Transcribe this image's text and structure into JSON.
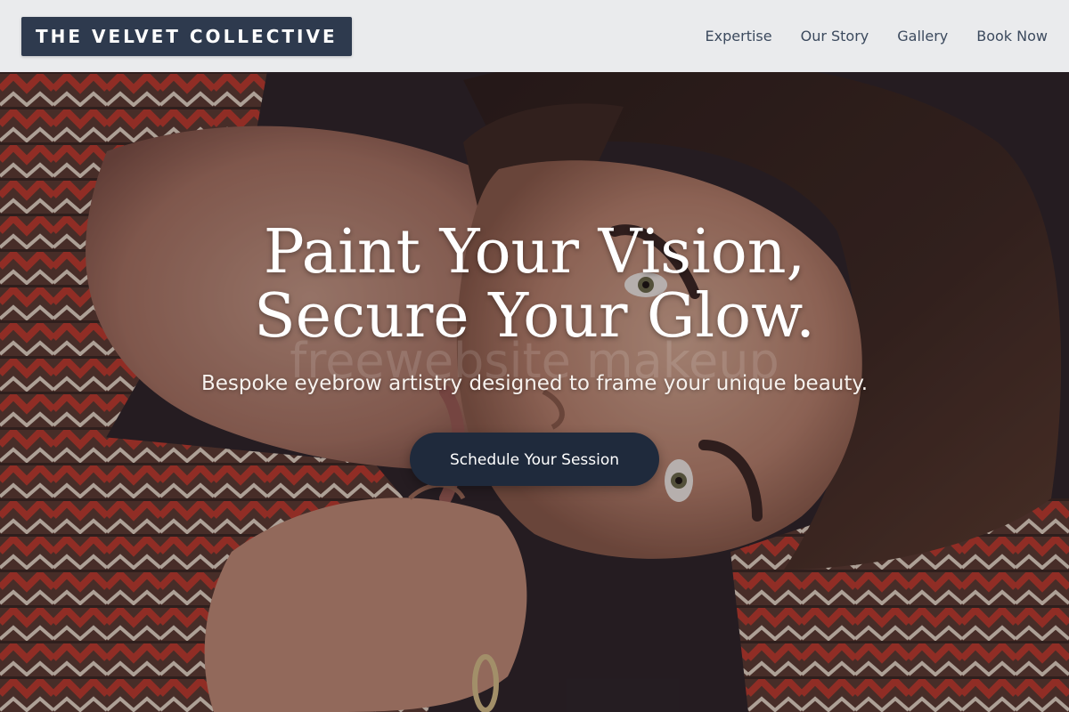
{
  "header": {
    "brand": "THE VELVET COLLECTIVE",
    "nav": [
      {
        "label": "Expertise"
      },
      {
        "label": "Our Story"
      },
      {
        "label": "Gallery"
      },
      {
        "label": "Book Now"
      }
    ]
  },
  "hero": {
    "title_line1": "Paint Your Vision,",
    "title_line2": "Secure Your Glow.",
    "watermark": "freewebsite makeup",
    "subtitle": "Bespoke eyebrow artistry designed to frame your unique beauty.",
    "cta_label": "Schedule Your Session",
    "image_description_icon": "portrait-photo"
  },
  "colors": {
    "header_bg": "#f3f4f6",
    "brand_bg": "#2e3a4e",
    "nav_text": "#3c4a5e",
    "cta_bg": "#1f2a3c",
    "hero_text": "#ffffff"
  }
}
